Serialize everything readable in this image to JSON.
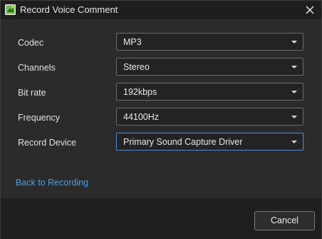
{
  "window": {
    "title": "Record Voice Comment",
    "icon": "app-logo-icon",
    "close_icon": "close-icon"
  },
  "form": {
    "rows": [
      {
        "label": "Codec",
        "value": "MP3"
      },
      {
        "label": "Channels",
        "value": "Stereo"
      },
      {
        "label": "Bit rate",
        "value": "192kbps"
      },
      {
        "label": "Frequency",
        "value": "44100Hz"
      },
      {
        "label": "Record Device",
        "value": "Primary Sound Capture Driver"
      }
    ]
  },
  "link": {
    "label": "Back to Recording"
  },
  "footer": {
    "cancel_label": "Cancel"
  },
  "colors": {
    "background": "#2b2b2b",
    "titlebar": "#1e1e1e",
    "link": "#4d9de0",
    "focus_border": "#4a8fe0",
    "icon_green": "#6cc04a"
  }
}
